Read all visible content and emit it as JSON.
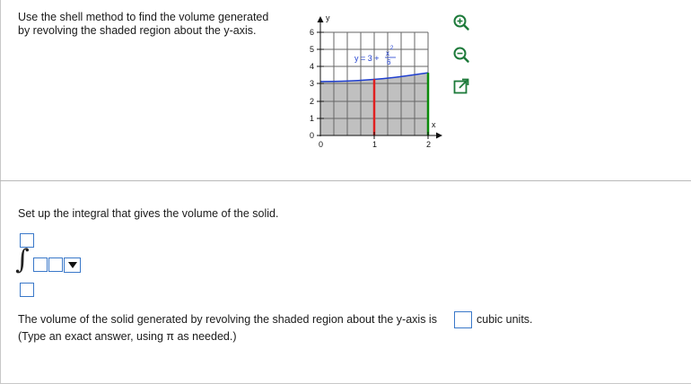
{
  "question": {
    "line1": "Use the shell method to find the volume generated",
    "line2": "by revolving the shaded region about the y-axis."
  },
  "graph": {
    "y_axis_label": "y",
    "x_axis_label": "x",
    "y_ticks": [
      "6",
      "5",
      "4",
      "3",
      "2",
      "1",
      "0"
    ],
    "x_ticks": [
      "0",
      "1",
      "2"
    ],
    "curve_label_prefix": "y = 3 +",
    "curve_label_numerator": "x",
    "curve_label_exponent": "2",
    "curve_label_denominator": "6",
    "colors": {
      "fill": "#c0c0c0",
      "curve": "#1f3fcf",
      "strip": "#e02020",
      "boundary": "#0a8a0a",
      "grid": "#666666"
    }
  },
  "tools": {
    "zoom_in": "zoom-in-icon",
    "zoom_out": "zoom-out-icon",
    "popout": "popout-icon"
  },
  "setup": {
    "prompt": "Set up the integral that gives the volume of the solid.",
    "upper_limit": "",
    "lower_limit": "",
    "integrand": "",
    "integral_sign": "∫",
    "differential": ""
  },
  "answer": {
    "prompt": "The volume of the solid generated by revolving the shaded region about the y-axis is",
    "value": "",
    "units": "cubic units.",
    "hint": "(Type an exact answer, using π as needed.)"
  }
}
